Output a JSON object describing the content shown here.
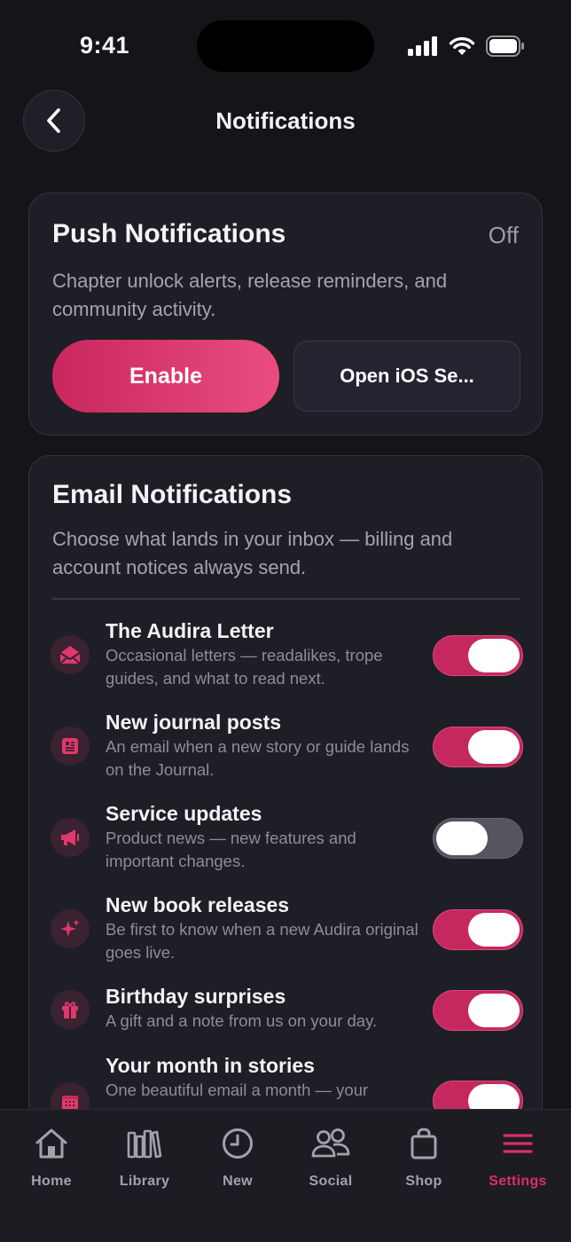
{
  "status_bar": {
    "time": "9:41"
  },
  "header": {
    "title": "Notifications"
  },
  "push": {
    "title": "Push Notifications",
    "state": "Off",
    "description": "Chapter unlock alerts, release reminders, and community activity.",
    "enable_label": "Enable",
    "ios_settings_label": "Open iOS Se..."
  },
  "email": {
    "title": "Email Notifications",
    "description": "Choose what lands in your inbox — billing and account notices always send.",
    "items": [
      {
        "title": "The Audira Letter",
        "subtitle": "Occasional letters — readalikes, trope guides, and what to read next.",
        "enabled": true,
        "icon": "envelope-open-icon"
      },
      {
        "title": "New journal posts",
        "subtitle": "An email when a new story or guide lands on the Journal.",
        "enabled": true,
        "icon": "newspaper-icon"
      },
      {
        "title": "Service updates",
        "subtitle": "Product news — new features and important changes.",
        "enabled": false,
        "icon": "megaphone-icon"
      },
      {
        "title": "New book releases",
        "subtitle": "Be first to know when a new Audira original goes live.",
        "enabled": true,
        "icon": "sparkles-icon"
      },
      {
        "title": "Birthday surprises",
        "subtitle": "A gift and a note from us on your day.",
        "enabled": true,
        "icon": "gift-icon"
      },
      {
        "title": "Your month in stories",
        "subtitle": "One beautiful email a month — your",
        "enabled": true,
        "icon": "calendar-icon"
      }
    ]
  },
  "tabbar": {
    "tabs": [
      {
        "label": "Home",
        "icon": "home-icon"
      },
      {
        "label": "Library",
        "icon": "library-icon"
      },
      {
        "label": "New",
        "icon": "clock-icon"
      },
      {
        "label": "Social",
        "icon": "users-icon"
      },
      {
        "label": "Shop",
        "icon": "shopping-bag-icon"
      },
      {
        "label": "Settings",
        "icon": "menu-icon",
        "active": true
      }
    ]
  },
  "colors": {
    "background": "#141419",
    "card": "#1e1e26",
    "accent": "#d92f66",
    "toggle_off": "#55555f"
  }
}
